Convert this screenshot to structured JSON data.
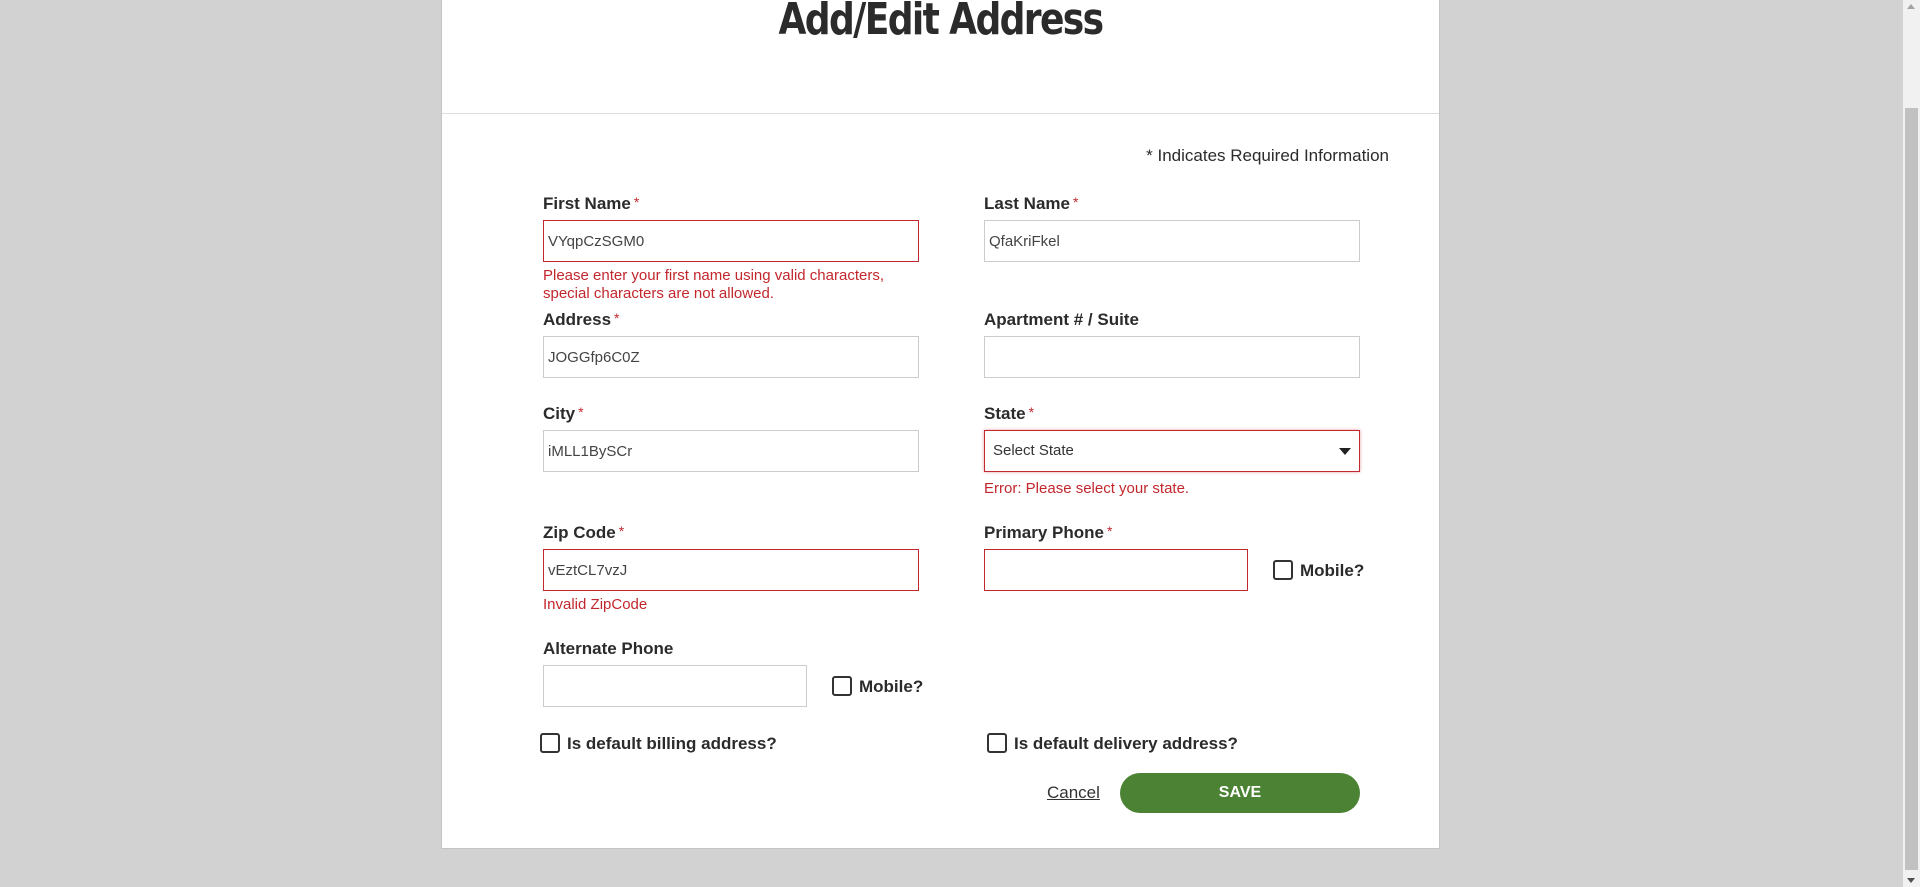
{
  "modal": {
    "title": "Add/Edit Address",
    "required_note": "* Indicates Required Information"
  },
  "form": {
    "required_mark": "*",
    "first_name": {
      "label": "First Name",
      "value": "VYqpCzSGM0",
      "error": "Please enter your first name using valid characters, special characters are not allowed."
    },
    "last_name": {
      "label": "Last Name",
      "value": "QfaKriFkel"
    },
    "address": {
      "label": "Address",
      "value": "JOGGfp6C0Z"
    },
    "apartment": {
      "label": "Apartment # / Suite",
      "value": ""
    },
    "city": {
      "label": "City",
      "value": "iMLL1BySCr"
    },
    "state": {
      "label": "State",
      "selected": "Select State",
      "error": "Error: Please select your state."
    },
    "zip": {
      "label": "Zip Code",
      "value": "vEztCL7vzJ",
      "error": "Invalid ZipCode"
    },
    "primary_phone": {
      "label": "Primary Phone",
      "value": "",
      "mobile_label": "Mobile?"
    },
    "alternate_phone": {
      "label": "Alternate Phone",
      "value": "",
      "mobile_label": "Mobile?"
    },
    "default_billing_label": "Is default billing address?",
    "default_delivery_label": "Is default delivery address?",
    "cancel_label": "Cancel",
    "save_label": "SAVE"
  },
  "colors": {
    "accent_green": "#4b8234",
    "error_red": "#c2272d"
  }
}
